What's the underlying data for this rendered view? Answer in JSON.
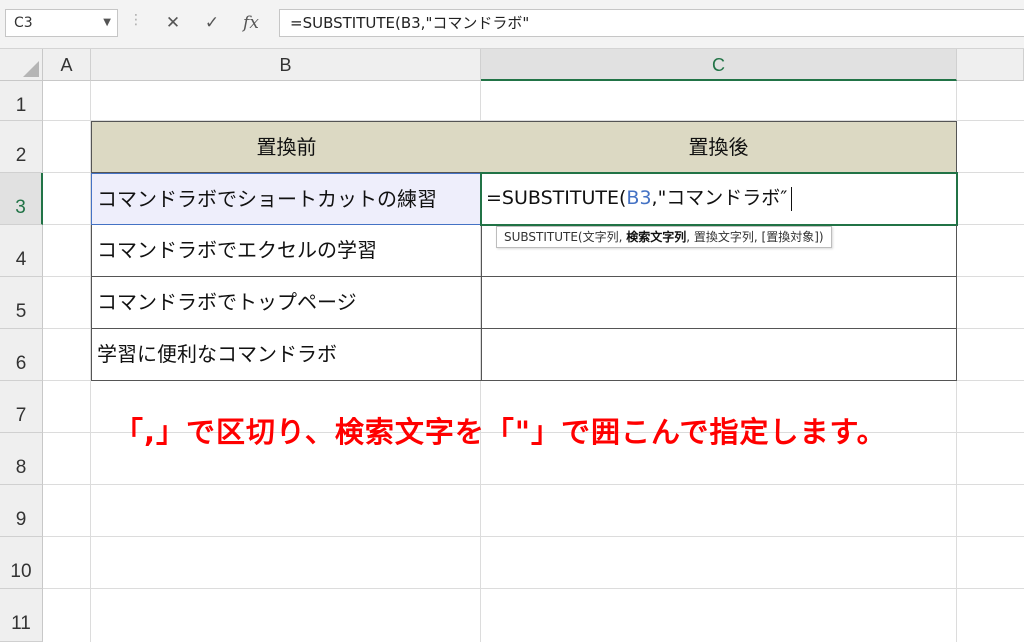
{
  "formula_bar": {
    "name_box": "C3",
    "cancel_icon": "✕",
    "enter_icon": "✓",
    "fx_icon": "fx",
    "formula": "=SUBSTITUTE(B3,\"コマンドラボ\""
  },
  "columns": [
    "A",
    "B",
    "C"
  ],
  "rows": [
    "1",
    "2",
    "3",
    "4",
    "5",
    "6",
    "7",
    "8",
    "9",
    "10",
    "11"
  ],
  "table": {
    "header_b": "置換前",
    "header_c": "置換後",
    "rows": [
      "コマンドラボでショートカットの練習",
      "コマンドラボでエクセルの学習",
      "コマンドラボでトップページ",
      "学習に便利なコマンドラボ"
    ]
  },
  "editing_cell": {
    "prefix": "=SUBSTITUTE(",
    "ref": "B3",
    "suffix": ",\"コマンドラボ″"
  },
  "tooltip": {
    "prefix": "SUBSTITUTE(文字列, ",
    "bold_arg": "検索文字列",
    "suffix": ", 置換文字列, [置換対象])"
  },
  "annotation": "「,」で区切り、検索文字を「\"」で囲こんで指定します。",
  "colors": {
    "header_fill": "#dcd9c3",
    "selected_green": "#217346",
    "ref_blue": "#4472c4",
    "annotation_red": "#ff0000"
  }
}
